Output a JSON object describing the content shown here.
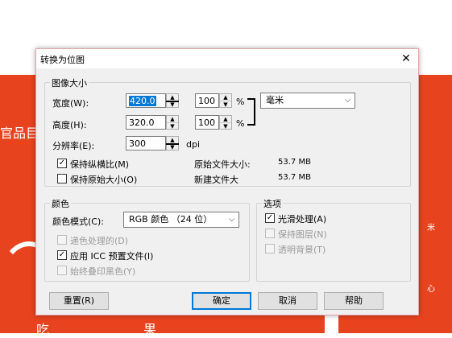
{
  "background": {
    "left_text": "官品目",
    "bottom_left": "吃",
    "bottom_mid": "果",
    "side_char1": "米",
    "side_char2": "心"
  },
  "dialog": {
    "title": "转换为位图",
    "close": "✕",
    "image_size": {
      "group_title": "图像大小",
      "width_label": "宽度(W):",
      "width_value": "420.0",
      "width_percent": "100",
      "height_label": "高度(H):",
      "height_value": "320.0",
      "height_percent": "100",
      "percent_sign": "%",
      "unit": "毫米",
      "resolution_label": "分辨率(E):",
      "resolution_value": "300",
      "resolution_unit": "dpi",
      "maintain_aspect": "保持纵横比(M)",
      "maintain_size": "保持原始大小(O)",
      "orig_size_label": "原始文件大小:",
      "orig_size_value": "53.7 MB",
      "new_size_label": "新建文件大",
      "new_size_value": "53.7 MB"
    },
    "color": {
      "group_title": "颜色",
      "mode_label": "颜色模式(C):",
      "mode_value": "RGB 颜色 （24 位）",
      "dither": "递色处理的(D)",
      "apply_icc": "应用 ICC 预置文件(I)",
      "overprint": "始终叠印黑色(Y)"
    },
    "options": {
      "group_title": "选项",
      "anti_alias": "光滑处理(A)",
      "keep_layers": "保持图层(N)",
      "transparent_bg": "透明背景(T)"
    },
    "buttons": {
      "reset": "重置(R)",
      "ok": "确定",
      "cancel": "取消",
      "help": "帮助"
    }
  }
}
